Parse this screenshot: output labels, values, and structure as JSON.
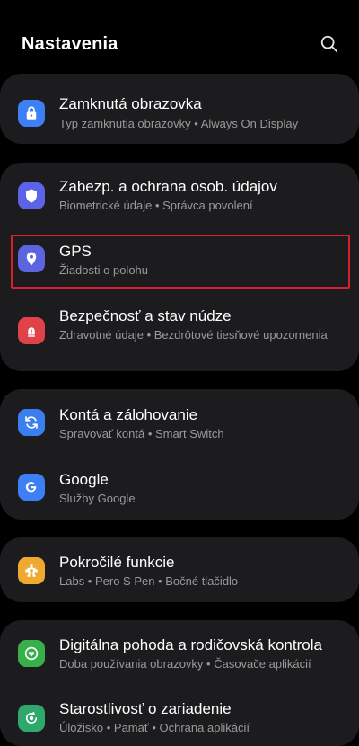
{
  "header": {
    "title": "Nastavenia",
    "search_icon": "search-icon"
  },
  "colors": {
    "background": "#000000",
    "card": "#1c1c1e",
    "subtitle": "#9a9a9a",
    "highlight": "#d6202a"
  },
  "items": [
    {
      "title": "Zamknutá obrazovka",
      "subtitle": "Typ zamknutia obrazovky  •  Always On Display",
      "icon": "lock-icon",
      "icon_color": "#3d7ff5"
    },
    {
      "title": "Zabezp. a ochrana osob. údajov",
      "subtitle": "Biometrické údaje  •  Správca povolení",
      "icon": "shield-icon",
      "icon_color": "#5b63e8"
    },
    {
      "title": "GPS",
      "subtitle": "Žiadosti o polohu",
      "icon": "location-pin-icon",
      "icon_color": "#5c64e0"
    },
    {
      "title": "Bezpečnosť a stav núdze",
      "subtitle": "Zdravotné údaje  •  Bezdrôtové tiesňové upozornenia",
      "icon": "emergency-alert-icon",
      "icon_color": "#e0424a"
    },
    {
      "title": "Kontá a zálohovanie",
      "subtitle": "Spravovať kontá  •  Smart Switch",
      "icon": "sync-icon",
      "icon_color": "#3b7ef0"
    },
    {
      "title": "Google",
      "subtitle": "Služby Google",
      "icon": "google-icon",
      "icon_color": "#3d7ff5"
    },
    {
      "title": "Pokročilé funkcie",
      "subtitle": "Labs  •  Pero S Pen  •  Bočné tlačidlo",
      "icon": "puzzle-gear-icon",
      "icon_color": "#f0a930"
    },
    {
      "title": "Digitálna pohoda a rodičovská kontrola",
      "subtitle": "Doba používania obrazovky  •  Časovače aplikácií",
      "icon": "heart-circle-icon",
      "icon_color": "#37b04a"
    },
    {
      "title": "Starostlivosť o zariadenie",
      "subtitle": "Úložisko  •  Pamäť  •  Ochrana aplikácií",
      "icon": "device-care-icon",
      "icon_color": "#2fa86e"
    }
  ]
}
